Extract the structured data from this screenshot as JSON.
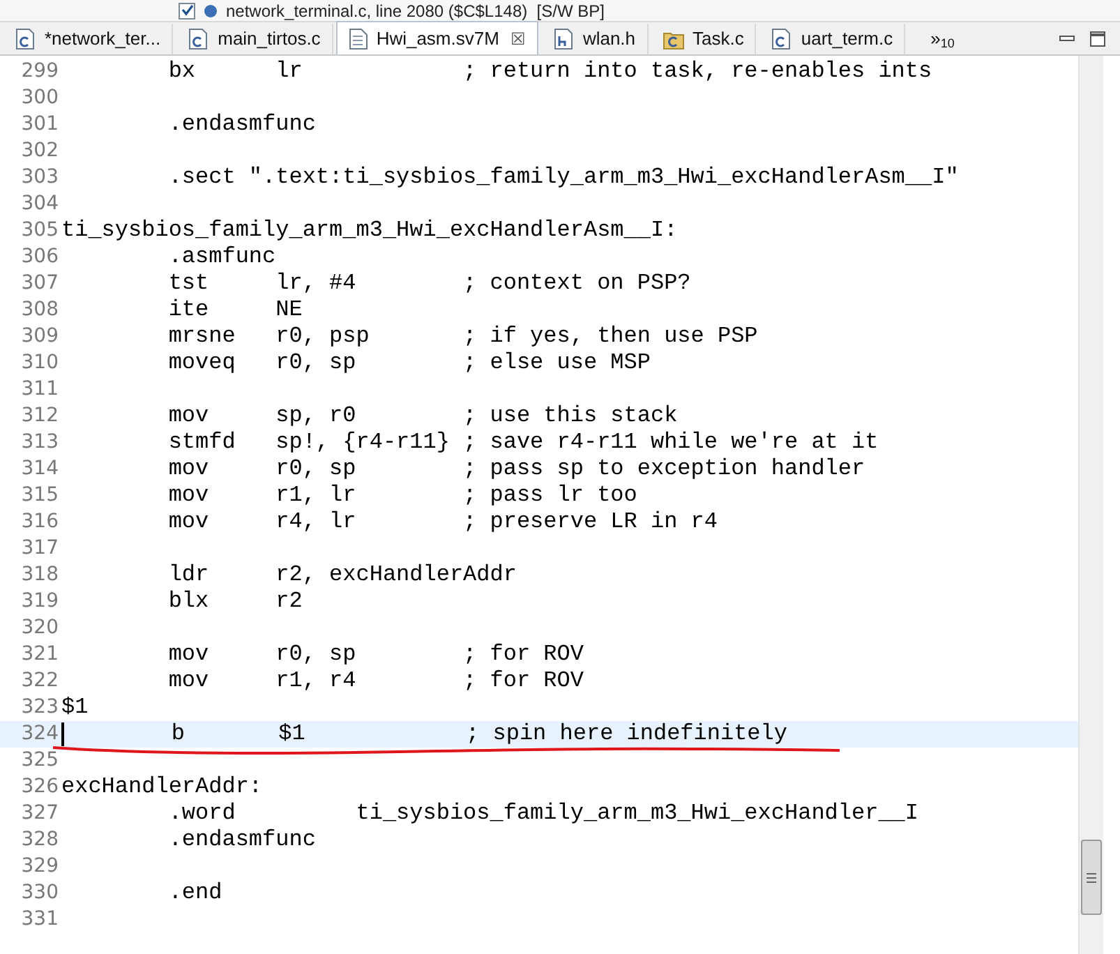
{
  "breakpoint_row": {
    "checked": true,
    "label": "network_terminal.c, line 2080 ($C$L148)  [S/W BP]"
  },
  "tabs": [
    {
      "label": "*network_ter...",
      "kind": "c",
      "selected": false
    },
    {
      "label": "main_tirtos.c",
      "kind": "c",
      "selected": false
    },
    {
      "label": "Hwi_asm.sv7M",
      "kind": "asm",
      "selected": true,
      "close": "☒"
    },
    {
      "label": "wlan.h",
      "kind": "h",
      "selected": false
    },
    {
      "label": "Task.c",
      "kind": "cfolder",
      "selected": false
    },
    {
      "label": "uart_term.c",
      "kind": "c",
      "selected": false
    }
  ],
  "overflow": {
    "chevron": "»",
    "count": "10"
  },
  "editor": {
    "lines": [
      {
        "number": "299",
        "text": "        bx      lr            ; return into task, re-enables ints",
        "selected": false
      },
      {
        "number": "300",
        "selected": false
      },
      {
        "number": "301",
        "text": "        .endasmfunc",
        "selected": false
      },
      {
        "number": "302",
        "selected": false
      },
      {
        "number": "303",
        "text": "        .sect \".text:ti_sysbios_family_arm_m3_Hwi_excHandlerAsm__I\"",
        "selected": false
      },
      {
        "number": "304",
        "selected": false
      },
      {
        "number": "305",
        "text": "ti_sysbios_family_arm_m3_Hwi_excHandlerAsm__I:",
        "selected": false
      },
      {
        "number": "306",
        "text": "        .asmfunc",
        "selected": false
      },
      {
        "number": "307",
        "text": "        tst     lr, #4        ; context on PSP?",
        "selected": false
      },
      {
        "number": "308",
        "text": "        ite     NE",
        "selected": false
      },
      {
        "number": "309",
        "text": "        mrsne   r0, psp       ; if yes, then use PSP",
        "selected": false
      },
      {
        "number": "310",
        "text": "        moveq   r0, sp        ; else use MSP",
        "selected": false
      },
      {
        "number": "311",
        "selected": false
      },
      {
        "number": "312",
        "text": "        mov     sp, r0        ; use this stack",
        "selected": false
      },
      {
        "number": "313",
        "text": "        stmfd   sp!, {r4-r11} ; save r4-r11 while we're at it",
        "selected": false
      },
      {
        "number": "314",
        "text": "        mov     r0, sp        ; pass sp to exception handler",
        "selected": false
      },
      {
        "number": "315",
        "text": "        mov     r1, lr        ; pass lr too",
        "selected": false
      },
      {
        "number": "316",
        "text": "        mov     r4, lr        ; preserve LR in r4",
        "selected": false
      },
      {
        "number": "317",
        "selected": false
      },
      {
        "number": "318",
        "text": "        ldr     r2, excHandlerAddr",
        "selected": false
      },
      {
        "number": "319",
        "text": "        blx     r2",
        "selected": false
      },
      {
        "number": "320",
        "selected": false
      },
      {
        "number": "321",
        "text": "        mov     r0, sp        ; for ROV",
        "selected": false
      },
      {
        "number": "322",
        "text": "        mov     r1, r4        ; for ROV",
        "selected": false
      },
      {
        "number": "323",
        "text": "$1",
        "selected": false
      },
      {
        "number": "324",
        "text": "        b       $1            ; spin here indefinitely",
        "selected": true
      },
      {
        "number": "325",
        "selected": false
      },
      {
        "number": "326",
        "text": "excHandlerAddr:",
        "selected": false
      },
      {
        "number": "327",
        "text": "        .word         ti_sysbios_family_arm_m3_Hwi_excHandler__I",
        "selected": false
      },
      {
        "number": "328",
        "text": "        .endasmfunc",
        "selected": false
      },
      {
        "number": "329",
        "selected": false
      },
      {
        "number": "330",
        "text": "        .end",
        "selected": false
      },
      {
        "number": "331",
        "selected": false
      }
    ]
  }
}
